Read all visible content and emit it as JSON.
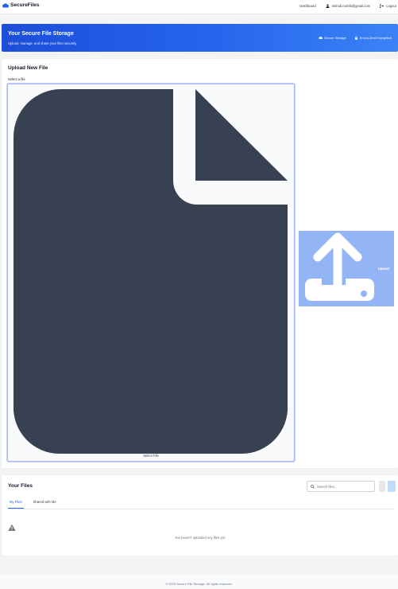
{
  "brand": {
    "name": "SecureFiles",
    "icon": "cloud-icon"
  },
  "nav": {
    "dashboard": "Dashboard",
    "user_email": "mkhub.mohib@gmail.com",
    "logout": "Logout"
  },
  "hero": {
    "title": "Your Secure File Storage",
    "subtitle": "Upload, manage, and share your files securely",
    "features": [
      "Secure Storage",
      "End-to-End Encryption"
    ]
  },
  "upload": {
    "title": "Upload New File",
    "select_label": "Select a file",
    "dropzone_text": "Select File",
    "button_label": "Upload"
  },
  "files": {
    "title": "Your Files",
    "search_placeholder": "Search files...",
    "tabs": [
      "My Files",
      "Shared with Me"
    ],
    "empty_message": "You haven't uploaded any files yet"
  },
  "footer": {
    "text": "© 2025 Secure File Storage. All rights reserved."
  },
  "colors": {
    "accent": "#2563eb",
    "upload_button": "#93b4f5",
    "file_icon": "#374151"
  }
}
